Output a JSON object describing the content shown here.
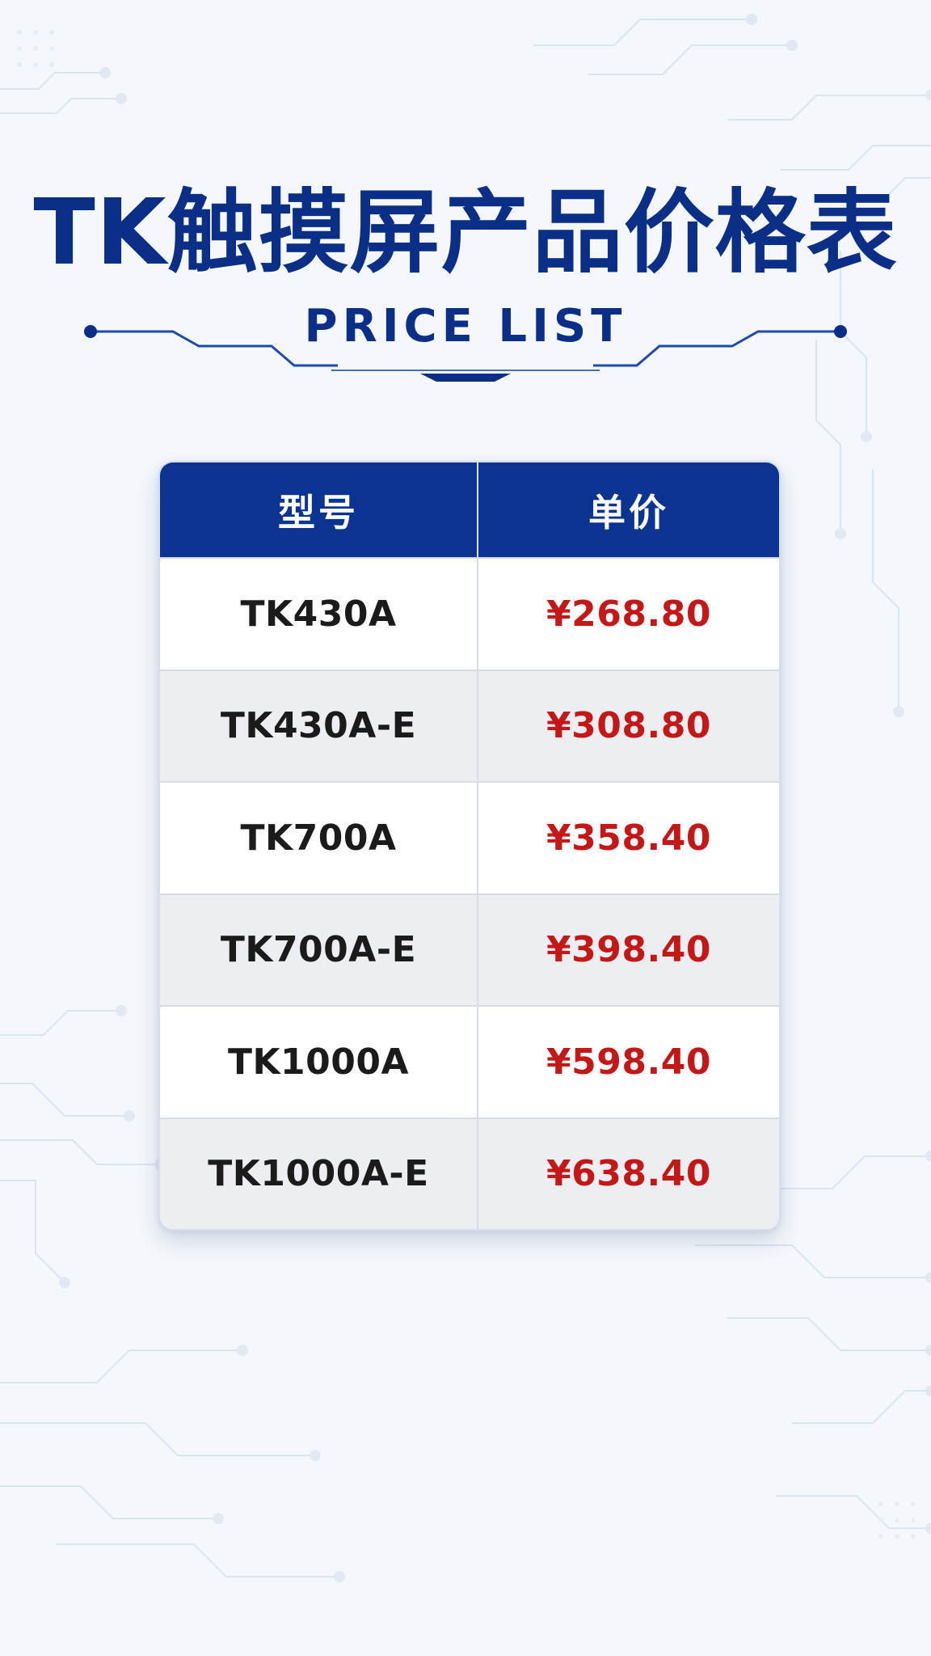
{
  "title": "TK触摸屏产品价格表",
  "subtitle": "PRICE LIST",
  "table": {
    "headers": [
      "型号",
      "单价"
    ],
    "rows": [
      {
        "model": "TK430A",
        "price": "¥268.80"
      },
      {
        "model": "TK430A-E",
        "price": "¥308.80"
      },
      {
        "model": "TK700A",
        "price": "¥358.40"
      },
      {
        "model": "TK700A-E",
        "price": "¥398.40"
      },
      {
        "model": "TK1000A",
        "price": "¥598.40"
      },
      {
        "model": "TK1000A-E",
        "price": "¥638.40"
      }
    ]
  },
  "colors": {
    "brand": "#0B2F86",
    "header_bg": "#0A348F",
    "price": "#C41717",
    "background": "#F4F7FB"
  }
}
